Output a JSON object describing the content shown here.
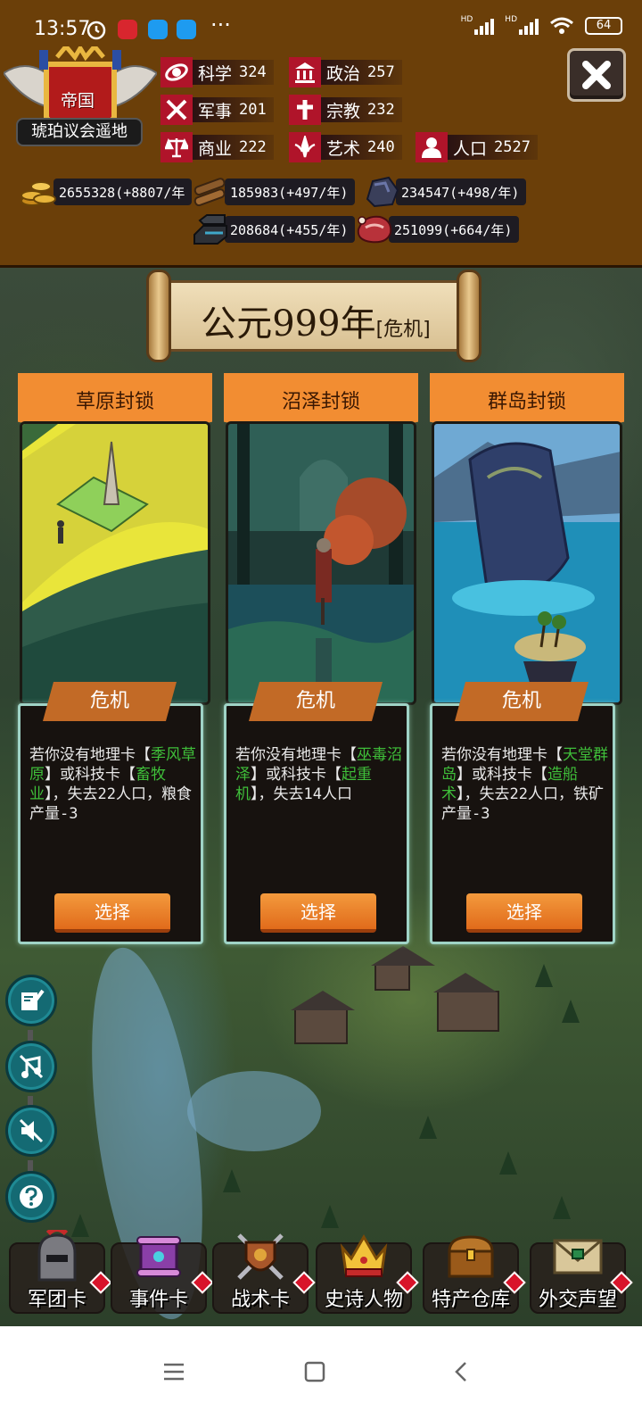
{
  "status_bar": {
    "time": "13:57",
    "battery": "64",
    "network_1": "HD",
    "network_2": "HD"
  },
  "emblem": {
    "title": "帝国",
    "name": "琥珀议会遥地"
  },
  "stats": [
    {
      "label": "科学",
      "value": "324",
      "icon": "science-icon"
    },
    {
      "label": "政治",
      "value": "257",
      "icon": "politics-icon"
    },
    {
      "label": "军事",
      "value": "201",
      "icon": "military-icon"
    },
    {
      "label": "宗教",
      "value": "232",
      "icon": "religion-icon"
    },
    {
      "label": "商业",
      "value": "222",
      "icon": "commerce-icon"
    },
    {
      "label": "艺术",
      "value": "240",
      "icon": "art-icon"
    },
    {
      "label": "人口",
      "value": "2527",
      "icon": "population-icon"
    }
  ],
  "resources": [
    {
      "name": "gold",
      "text": "2655328(+8807/年",
      "icon": "gold-coins-icon"
    },
    {
      "name": "wood",
      "text": "185983(+497/年)",
      "icon": "wood-icon"
    },
    {
      "name": "ore",
      "text": "234547(+498/年)",
      "icon": "ore-icon"
    },
    {
      "name": "iron",
      "text": "208684(+455/年)",
      "icon": "iron-ingot-icon"
    },
    {
      "name": "meat",
      "text": "251099(+664/年)",
      "icon": "meat-icon"
    }
  ],
  "banner": {
    "year": "公元999年",
    "tag": "[危机]"
  },
  "cards": [
    {
      "title": "草原封锁",
      "tag": "危机",
      "desc_1": "若你没有地理卡",
      "desc_2": "【",
      "hl_1": "季风草原",
      "desc_3": "】或科技",
      "desc_4": "卡【",
      "hl_2": "畜牧业",
      "desc_5": "】，失去22人口，粮食产量-3",
      "button": "选择"
    },
    {
      "title": "沼泽封锁",
      "tag": "危机",
      "desc_1": "若你没有地理卡",
      "desc_2": "【",
      "hl_1": "巫毒沼泽",
      "desc_3": "】或科技",
      "desc_4": "卡【",
      "hl_2": "起重机",
      "desc_5": "】，失去14人口",
      "button": "选择"
    },
    {
      "title": "群岛封锁",
      "tag": "危机",
      "desc_1": "若你没有地理卡",
      "desc_2": "【",
      "hl_1": "天堂群岛",
      "desc_3": "】或科技",
      "desc_4": "卡【",
      "hl_2": "造船术",
      "desc_5": "】，失去22人口，铁矿产量-3",
      "button": "选择"
    }
  ],
  "side_buttons": [
    "journal-icon",
    "music-off-icon",
    "sound-off-icon",
    "help-icon"
  ],
  "bottom_nav": [
    {
      "label": "军团卡",
      "icon": "helmet-icon"
    },
    {
      "label": "事件卡",
      "icon": "scroll-icon"
    },
    {
      "label": "战术卡",
      "icon": "shield-swords-icon"
    },
    {
      "label": "史诗人物",
      "icon": "crown-icon"
    },
    {
      "label": "特产仓库",
      "icon": "treasure-chest-icon"
    },
    {
      "label": "外交声望",
      "icon": "envelope-icon"
    }
  ],
  "colors": {
    "header_bg": "#6b3f09",
    "card_head": "#f28d32",
    "highlight_green": "#3fbf3a",
    "button_orange": "#e16b1b",
    "stat_red": "#b0142a"
  }
}
